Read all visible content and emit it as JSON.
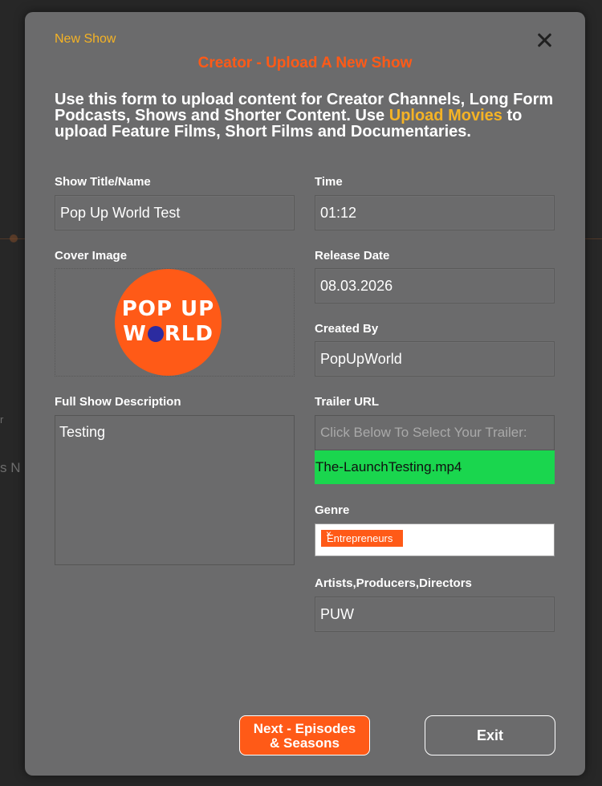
{
  "background": {
    "text_left": "s N",
    "text_left2": "r"
  },
  "modal": {
    "tag": "New Show",
    "title": "Creator - Upload A New Show",
    "intro_part1": "Use this form to upload content for Creator Channels, Long Form Podcasts, Shows and Shorter Content. Use ",
    "intro_link": "Upload Movies",
    "intro_part2": " to upload Feature Films, Short Films and Documentaries."
  },
  "fields": {
    "show_title_label": "Show Title/Name",
    "show_title_value": "Pop Up World Test",
    "time_label": "Time",
    "time_value": "01:12",
    "cover_label": "Cover Image",
    "release_label": "Release Date",
    "release_value": "08.03.2026",
    "created_by_label": "Created By",
    "created_by_value": "PopUpWorld",
    "description_label": "Full Show Description",
    "description_value": "Testing",
    "trailer_label": "Trailer URL",
    "trailer_placeholder": "Click Below To Select Your Trailer:",
    "trailer_file": "The-LaunchTesting.mp4",
    "genre_label": "Genre",
    "genre_chip": "Entrepreneurs",
    "genre_chip_remove": "×",
    "artists_label": "Artists,Producers,Directors",
    "artists_value": "PUW"
  },
  "logo": {
    "line1": "POP UP",
    "line2_prefix": "W",
    "line2_suffix": "RLD"
  },
  "buttons": {
    "next_line1": "Next - Episodes",
    "next_line2": "& Seasons",
    "exit": "Exit"
  },
  "colors": {
    "accent": "#ff5a17",
    "highlight": "#f5b325",
    "success": "#1ad64e",
    "modal_bg": "#6b6b6c"
  },
  "icons": {
    "close": "close-icon"
  }
}
